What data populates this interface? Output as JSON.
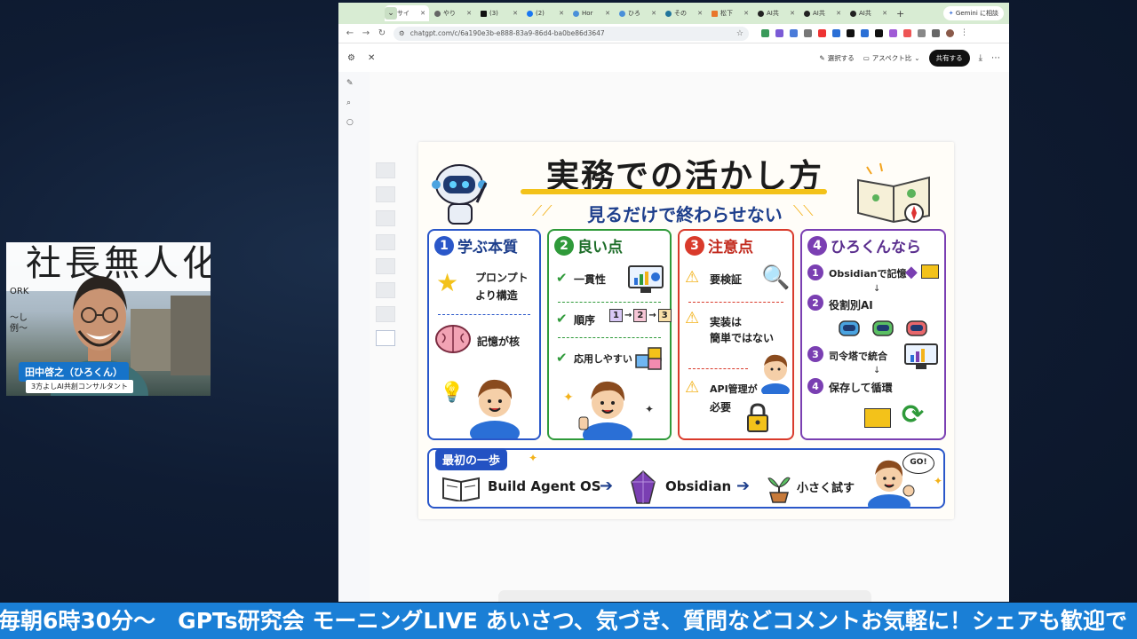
{
  "webcam": {
    "sign_text": "社長無人化",
    "work_text": "ORK",
    "side_text_1": "〜し",
    "side_text_2": "例〜",
    "name": "田中啓之（ひろくん）",
    "title": "3方よしAI共創コンサルタント"
  },
  "browser": {
    "tabs": [
      {
        "label": "サイ",
        "active": true
      },
      {
        "label": "やり"
      },
      {
        "label": "(3)"
      },
      {
        "label": "(2)"
      },
      {
        "label": "Hor"
      },
      {
        "label": "ひろ"
      },
      {
        "label": "その"
      },
      {
        "label": "松下"
      },
      {
        "label": "AI共"
      },
      {
        "label": "AI共"
      },
      {
        "label": "AI共"
      }
    ],
    "gemini_label": "Gemini に相談",
    "url": "chatgpt.com/c/6a190e3b-e888-83a9-86d4-ba0be86d3647",
    "header": {
      "select_label": "選択する",
      "aspect_label": "アスペクト比",
      "share_label": "共有する"
    }
  },
  "infographic": {
    "title": "実務での活かし方",
    "subtitle": "見るだけで終わらせない",
    "cards": [
      {
        "num": "1",
        "heading": "学ぶ本質",
        "items": [
          "プロンプト",
          "より構造",
          "記憶が核"
        ]
      },
      {
        "num": "2",
        "heading": "良い点",
        "items": [
          "一貫性",
          "順序",
          "応用しやすい"
        ],
        "steps": [
          "1",
          "2",
          "3"
        ]
      },
      {
        "num": "3",
        "heading": "注意点",
        "items": [
          "要検証",
          "実装は",
          "簡単ではない",
          "API管理が",
          "必要"
        ]
      },
      {
        "num": "4",
        "heading": "ひろくんなら",
        "items": [
          "Obsidianで記憶",
          "役割別AI",
          "司令塔で統合",
          "保存して循環"
        ]
      }
    ],
    "first_step": {
      "label": "最初の一歩",
      "step1": "Build Agent OS",
      "step2": "Obsidian",
      "step3": "小さく試す",
      "bubble": "GO!"
    }
  },
  "ticker_text": "毎朝6時30分〜　GPTs研究会 モーニングLIVE あいさつ、気づき、質問などコメントお気軽に！シェアも歓迎で",
  "colors": {
    "card1": "#2a57c9",
    "card2": "#2f9a3a",
    "card3": "#d93a2b",
    "card4": "#7a3fb2",
    "ticker": "#1a7fd6"
  }
}
